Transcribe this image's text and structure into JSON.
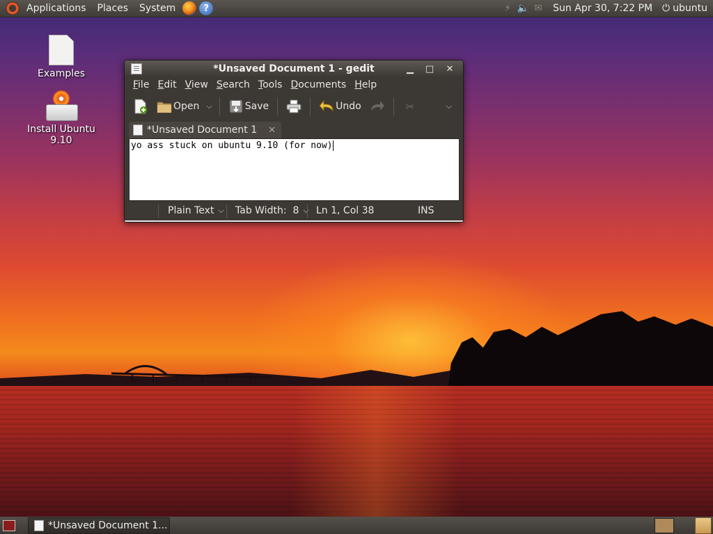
{
  "top_panel": {
    "menus": [
      "Applications",
      "Places",
      "System"
    ],
    "clock": "Sun Apr 30,  7:22 PM",
    "user": "ubuntu"
  },
  "desktop": {
    "icons": [
      {
        "label": "Examples",
        "icon": "folder-document-icon"
      },
      {
        "label": "Install Ubuntu 9.10",
        "icon": "installer-icon"
      }
    ]
  },
  "gedit": {
    "title": "*Unsaved Document 1 - gedit",
    "menu": [
      "File",
      "Edit",
      "View",
      "Search",
      "Tools",
      "Documents",
      "Help"
    ],
    "toolbar": {
      "new_icon": "new-document-icon",
      "open_label": "Open",
      "save_label": "Save",
      "print_icon": "print-icon",
      "undo_label": "Undo",
      "redo_icon": "redo-icon",
      "cut_icon": "cut-icon"
    },
    "tab": {
      "label": "*Unsaved Document 1"
    },
    "editor_text": "yo ass stuck on ubuntu 9.10 (for now)",
    "status": {
      "language": "Plain Text",
      "tab_width": "Tab Width:  8",
      "position": "Ln 1, Col 38",
      "mode": "INS"
    }
  },
  "bottom_panel": {
    "task_label": "*Unsaved Document 1..."
  },
  "colors": {
    "panel": "#3c3833",
    "accent": "#e95420"
  }
}
